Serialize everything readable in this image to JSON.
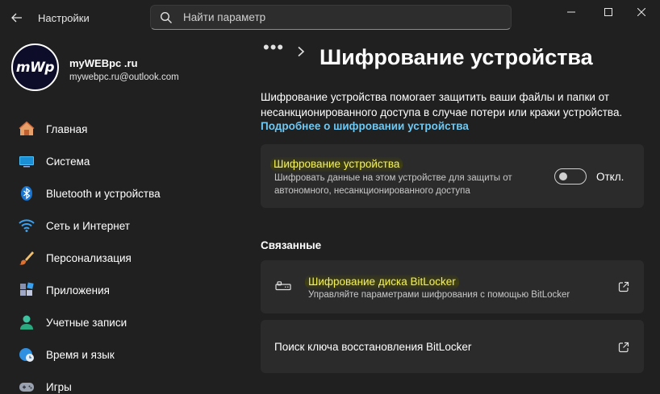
{
  "window": {
    "app_title": "Настройки",
    "search_placeholder": "Найти параметр"
  },
  "user": {
    "avatar_text": "mWp",
    "name": "myWEBpc .ru",
    "email": "mywebpc.ru@outlook.com"
  },
  "sidebar": {
    "items": [
      {
        "label": "Главная",
        "icon": "home-icon"
      },
      {
        "label": "Система",
        "icon": "monitor-icon"
      },
      {
        "label": "Bluetooth и устройства",
        "icon": "bluetooth-icon"
      },
      {
        "label": "Сеть и Интернет",
        "icon": "wifi-icon"
      },
      {
        "label": "Персонализация",
        "icon": "brush-icon"
      },
      {
        "label": "Приложения",
        "icon": "apps-icon"
      },
      {
        "label": "Учетные записи",
        "icon": "account-icon"
      },
      {
        "label": "Время и язык",
        "icon": "clock-globe-icon"
      },
      {
        "label": "Игры",
        "icon": "gamepad-icon"
      }
    ]
  },
  "main": {
    "breadcrumb_more": "•••",
    "title": "Шифрование устройства",
    "description": "Шифрование устройства помогает защитить ваши файлы и папки от несанкционированного доступа в случае потери или кражи устройства.",
    "learn_more": "Подробнее о шифровании устройства",
    "encryption_card": {
      "title": "Шифрование устройства",
      "subtitle": "Шифровать данные на этом устройстве для защиты от автономного, несанкционированного доступа",
      "toggle_state": "Откл.",
      "toggle_on": false
    },
    "related_header": "Связанные",
    "related": [
      {
        "title": "Шифрование диска BitLocker",
        "subtitle": "Управляйте параметрами шифрования с помощью BitLocker"
      },
      {
        "title": "Поиск ключа восстановления BitLocker"
      }
    ]
  },
  "colors": {
    "background": "#202020",
    "card": "#2b2b2b",
    "link": "#6fc8f2",
    "highlight_text": "#f4f25a"
  }
}
